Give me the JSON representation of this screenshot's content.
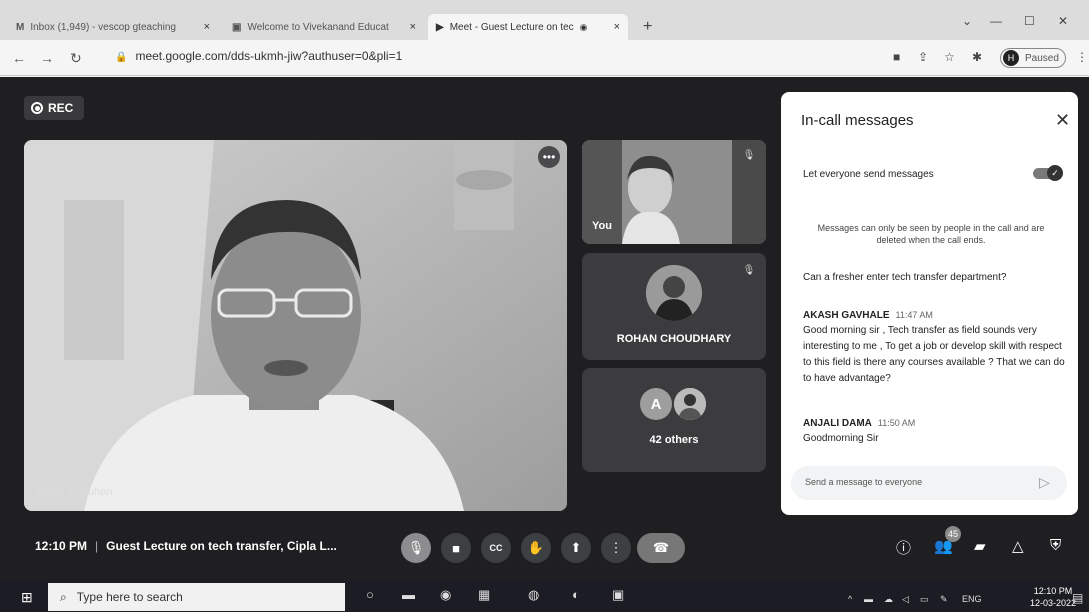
{
  "browser": {
    "tabs": [
      {
        "icon": "M",
        "title": "Inbox (1,949) - vescop gteaching",
        "close": "×"
      },
      {
        "icon": "▣",
        "title": "Welcome to Vivekanand Educat",
        "close": "×"
      },
      {
        "icon": "▶",
        "title": "Meet - Guest Lecture on tec",
        "close": "×"
      }
    ],
    "new_tab": "+",
    "url": "meet.google.com/dds-ukmh-jiw?authuser=0&pli=1",
    "profile_initial": "H",
    "profile_label": "Paused"
  },
  "meet": {
    "rec_label": "REC",
    "main_speaker_name": "Jitesh Chauhan",
    "self_label": "You",
    "participant_name": "ROHAN CHOUDHARY",
    "others_initial": "A",
    "others_label": "42 others",
    "time": "12:10 PM",
    "meeting_title": "Guest Lecture on tech transfer, Cipla L...",
    "participant_count": "45"
  },
  "panel": {
    "title": "In-call messages",
    "toggle_label": "Let everyone send messages",
    "note": "Messages can only be seen by people in the call and are deleted when the call ends.",
    "messages": [
      {
        "author": "",
        "time": "",
        "text": "Can a fresher enter tech transfer department?"
      },
      {
        "author": "AKASH GAVHALE",
        "time": "11:47 AM",
        "text": "Good morning sir , Tech transfer as field sounds very interesting to me , To get a job or develop skill with respect to this field is there any courses available ? That we can do to have advantage?"
      },
      {
        "author": "ANJALI DAMA",
        "time": "11:50 AM",
        "text": "Goodmorning Sir"
      }
    ],
    "input_placeholder": "Send a message to everyone"
  },
  "taskbar": {
    "search_placeholder": "Type here to search",
    "lang": "ENG",
    "time": "12:10 PM",
    "date": "12-03-2022"
  }
}
